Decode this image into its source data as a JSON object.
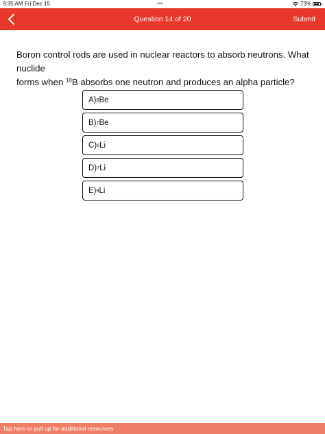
{
  "status": {
    "time": "9:35 AM",
    "date": "Fri Dec 15",
    "dots": "•••",
    "battery": "73%"
  },
  "nav": {
    "title": "Question 14 of 20",
    "submit_label": "Submit"
  },
  "question": {
    "line1": "Boron control rods are used in nuclear reactors to absorb neutrons. What nuclide",
    "line2_prefix": "forms when ",
    "line2_sup": "10",
    "line2_suffix": "B absorbs one neutron and produces an alpha particle?"
  },
  "options": [
    {
      "prefix": "A) ",
      "mass": "8",
      "symbol": "Be"
    },
    {
      "prefix": "B) ",
      "mass": "7",
      "symbol": "Be"
    },
    {
      "prefix": "C) ",
      "mass": "6",
      "symbol": "Li"
    },
    {
      "prefix": "D) ",
      "mass": "7",
      "symbol": "Li"
    },
    {
      "prefix": "E) ",
      "mass": "9",
      "symbol": "Li"
    }
  ],
  "resources": {
    "label": "Tap here or pull up for additional resources"
  },
  "colors": {
    "nav_bar": "#e8382b",
    "resources_bar": "#ef7e66"
  },
  "icons": {
    "back": "chevron-left-icon",
    "wifi": "wifi-icon",
    "battery": "battery-icon"
  }
}
